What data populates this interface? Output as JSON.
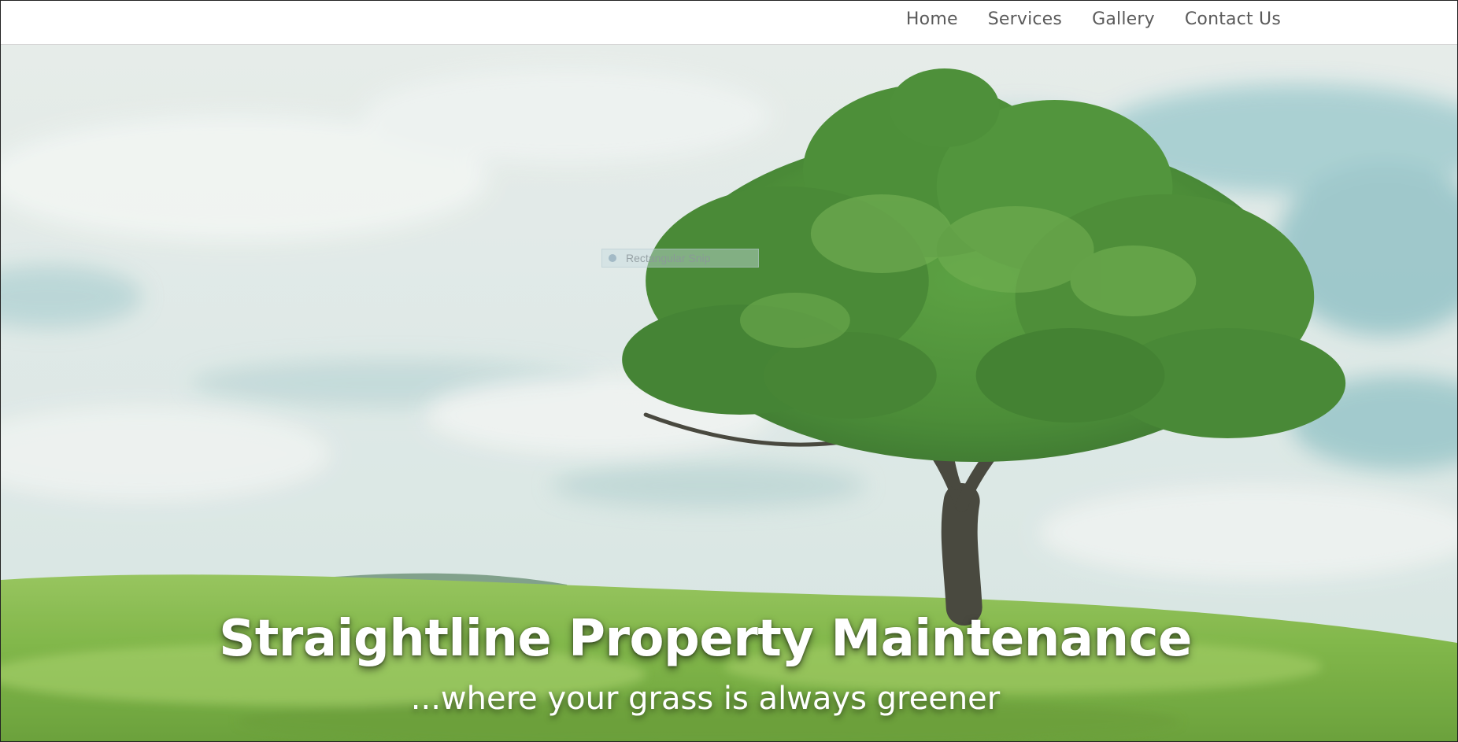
{
  "nav": {
    "items": [
      {
        "label": "Home"
      },
      {
        "label": "Services"
      },
      {
        "label": "Gallery"
      },
      {
        "label": "Contact Us"
      }
    ]
  },
  "overlay": {
    "snip_label": "Rectangular Snip"
  },
  "hero": {
    "title": "Straightline Property Maintenance",
    "tagline": "...where your grass is always greener"
  },
  "colors": {
    "sky": "#d9e6e3",
    "grass": "#7fb63f",
    "foliage": "#3f8a2c",
    "trunk": "#3b3a30"
  }
}
